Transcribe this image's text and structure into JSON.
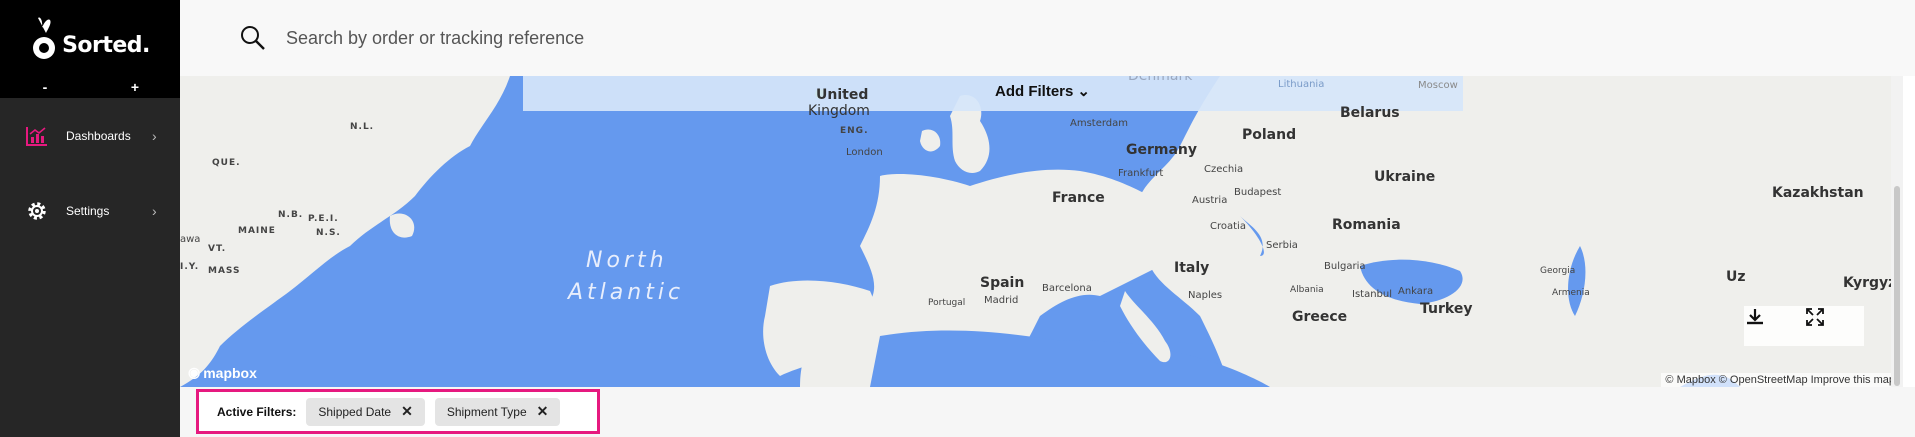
{
  "brand": {
    "name": "Sorted."
  },
  "zoom": {
    "minus": "-",
    "plus": "+"
  },
  "nav": {
    "items": [
      {
        "label": "Dashboards",
        "icon": "bar-chart-icon",
        "chevron": "›"
      },
      {
        "label": "Settings",
        "icon": "gear-icon",
        "chevron": "›"
      }
    ]
  },
  "search": {
    "placeholder": "Search by order or tracking reference"
  },
  "map": {
    "add_filters": "Add Filters",
    "labels": {
      "united": "United",
      "kingdom": "Kingdom",
      "eng": "ENG.",
      "london": "London",
      "amsterdam": "Amsterdam",
      "denmark": "Denmark",
      "lithuania": "Lithuania",
      "moscow": "Moscow",
      "belarus": "Belarus",
      "poland": "Poland",
      "germany": "Germany",
      "frankfurt": "Frankfurt",
      "czechia": "Czechia",
      "france": "France",
      "austria": "Austria",
      "budapest": "Budapest",
      "ukraine": "Ukraine",
      "kazakhstan": "Kazakhstan",
      "romania": "Romania",
      "croatia": "Croatia",
      "serbia": "Serbia",
      "bulgaria": "Bulgaria",
      "italy": "Italy",
      "spain": "Spain",
      "madrid": "Madrid",
      "barcelona": "Barcelona",
      "portugal": "Portugal",
      "naples": "Naples",
      "albania": "Albania",
      "istanbul": "Istanbul",
      "ankara": "Ankara",
      "turkey": "Turkey",
      "greece": "Greece",
      "georgia": "Georgia",
      "armenia": "Armenia",
      "uz": "Uz",
      "kyrgyz": "Kyrgyz",
      "nl": "N.L.",
      "que": "QUE.",
      "nb": "N.B.",
      "pei": "P.E.I.",
      "ns": "N.S.",
      "maine": "MAINE",
      "vt": "VT.",
      "ny": "I.Y.",
      "mass": "MASS",
      "awa": "awa",
      "north": "North",
      "atlantic": "Atlantic"
    },
    "mapbox": "mapbox",
    "attribution": "© Mapbox © OpenStreetMap   Improve this map"
  },
  "active_filters": {
    "title": "Active Filters:",
    "chips": [
      {
        "label": "Shipped Date",
        "remove": "✕"
      },
      {
        "label": "Shipment Type",
        "remove": "✕"
      }
    ]
  }
}
